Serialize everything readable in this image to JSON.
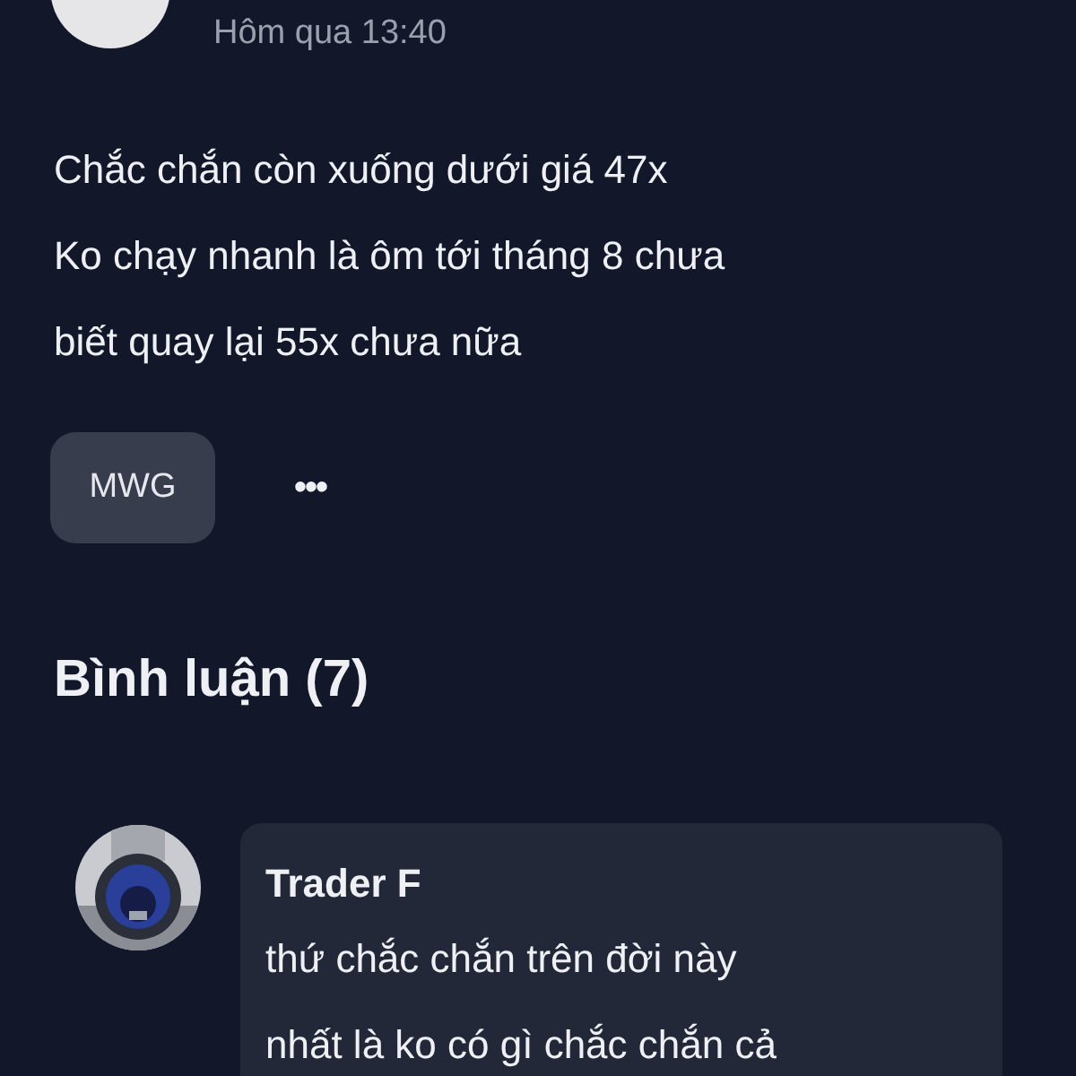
{
  "post": {
    "timestamp": "Hôm qua 13:40",
    "lines": [
      "Chắc chắn còn xuống dưới giá 47x",
      "Ko chạy nhanh là ôm tới tháng 8 chưa",
      "biết quay lại 55x chưa nữa"
    ],
    "tags": [
      "MWG"
    ],
    "more": "•••"
  },
  "comments": {
    "heading": "Bình luận (7)",
    "items": [
      {
        "author": "Trader F",
        "avatar": {
          "kind": "picture"
        },
        "lines": [
          "thứ chắc chắn trên đời này",
          "nhất là ko có gì chắc chắn cả"
        ]
      }
    ]
  }
}
